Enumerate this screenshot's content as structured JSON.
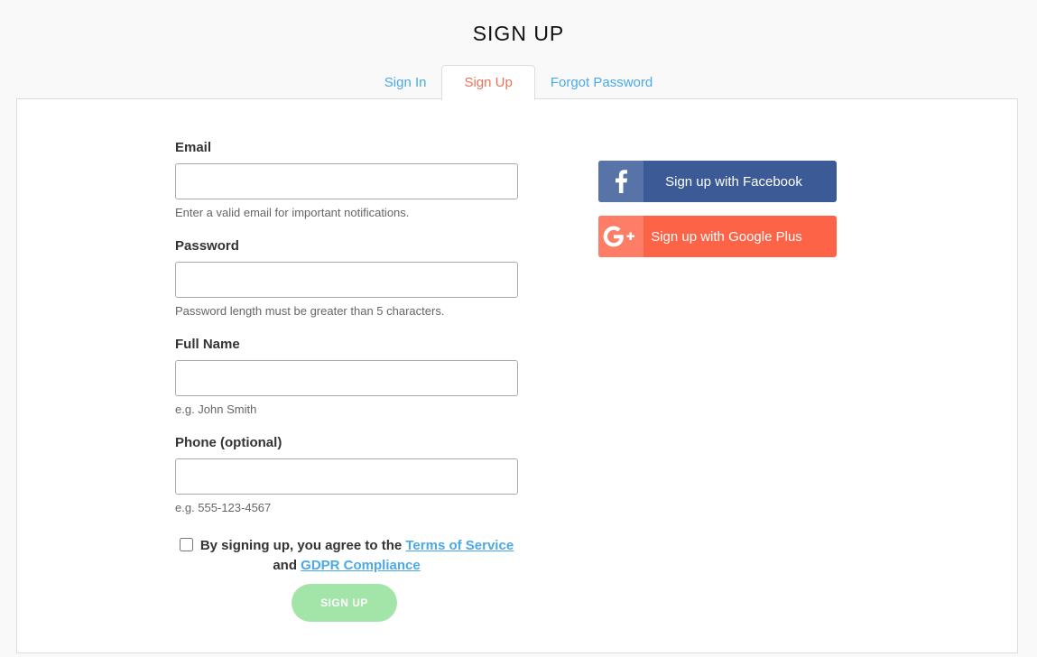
{
  "header": {
    "title": "SIGN UP"
  },
  "tabs": [
    {
      "label": "Sign In",
      "active": false
    },
    {
      "label": "Sign Up",
      "active": true
    },
    {
      "label": "Forgot Password",
      "active": false
    }
  ],
  "form": {
    "email": {
      "label": "Email",
      "value": "",
      "placeholder": "",
      "help": "Enter a valid email for important notifications."
    },
    "password": {
      "label": "Password",
      "value": "",
      "placeholder": "",
      "help": "Password length must be greater than 5 characters."
    },
    "full_name": {
      "label": "Full Name",
      "value": "",
      "placeholder": "",
      "help": "e.g. John Smith"
    },
    "phone": {
      "label": "Phone (optional)",
      "value": "",
      "placeholder": "",
      "help": "e.g. 555-123-4567"
    },
    "agreement": {
      "checked": false,
      "text_before": "By signing up, you agree to the",
      "terms_link": "Terms of Service",
      "text_and": "and",
      "gdpr_link": "GDPR Compliance"
    },
    "submit_label": "SIGN UP"
  },
  "social": {
    "facebook": {
      "label": "Sign up with Facebook",
      "icon": "facebook-icon",
      "color": "#3c5a96"
    },
    "google": {
      "label": "Sign up with Google Plus",
      "icon": "google-plus-icon",
      "color": "#fd6347"
    }
  },
  "colors": {
    "link": "#4aa9e6",
    "active_tab": "#f0705a",
    "submit_disabled": "#a3e4a9"
  }
}
